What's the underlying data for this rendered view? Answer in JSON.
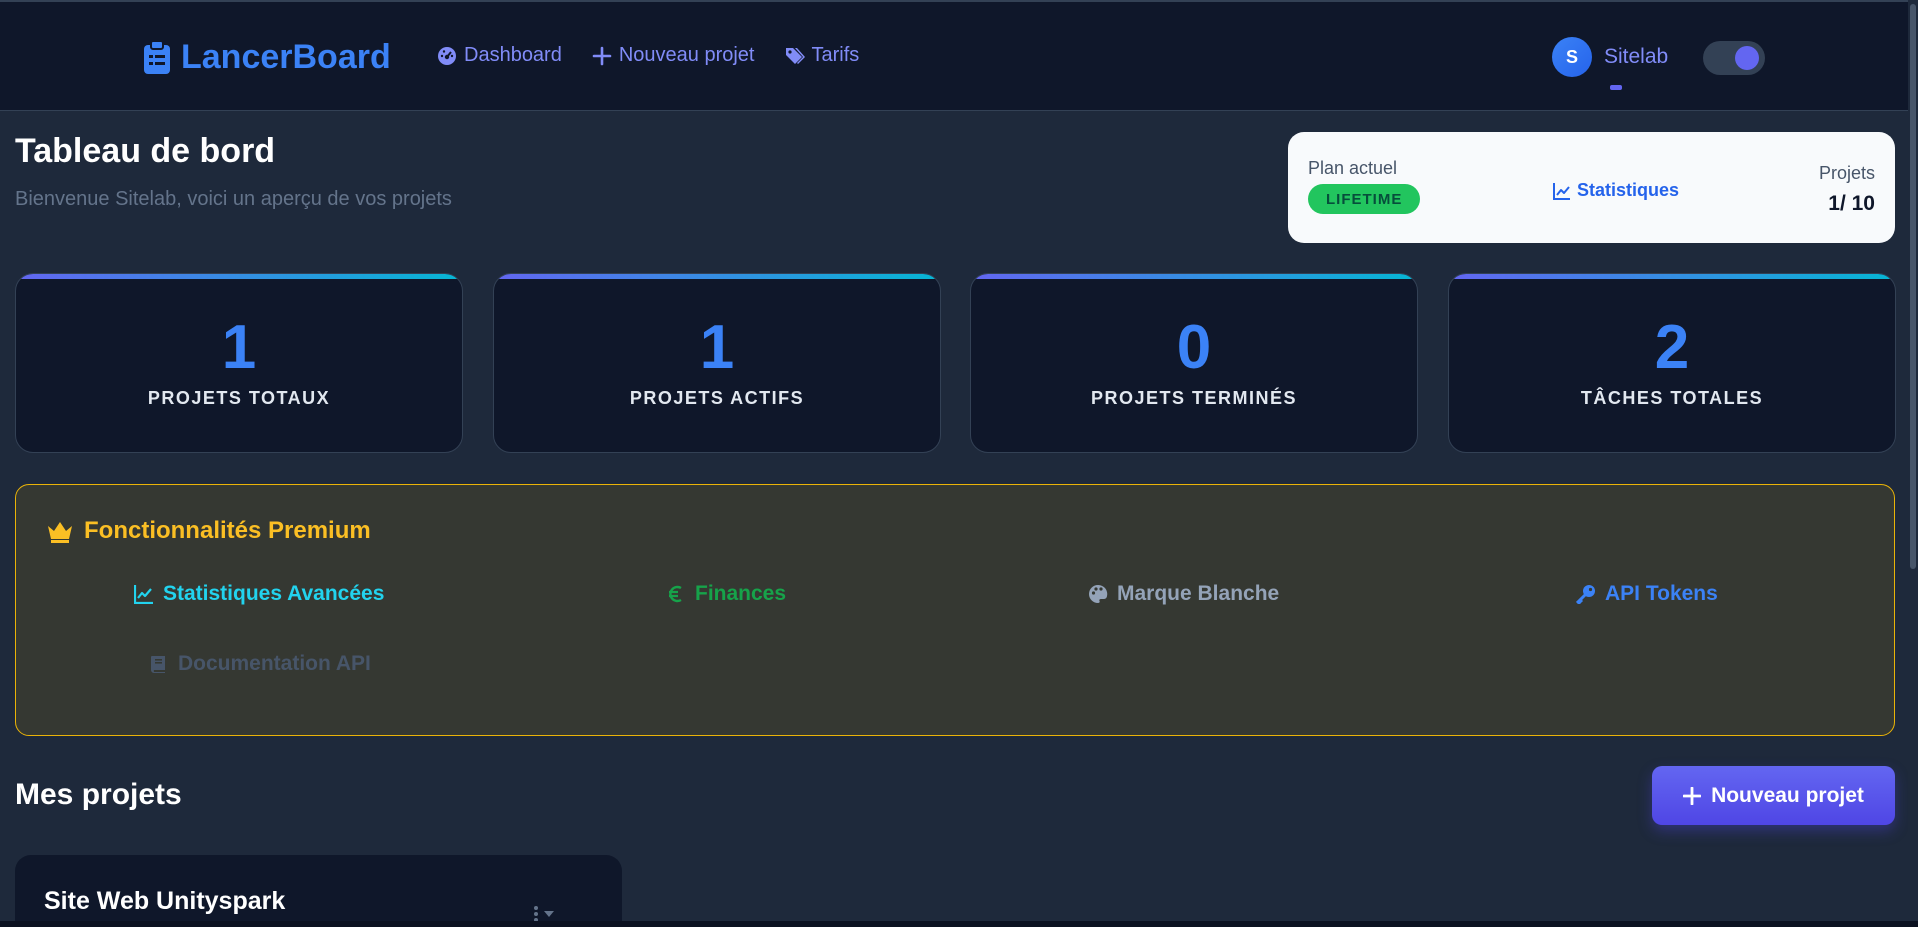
{
  "navbar": {
    "brand": "LancerBoard",
    "links": [
      {
        "label": "Dashboard",
        "icon": "gauge-icon"
      },
      {
        "label": "Nouveau projet",
        "icon": "plus-icon"
      },
      {
        "label": "Tarifs",
        "icon": "tags-icon"
      }
    ],
    "user": {
      "initial": "S",
      "name": "Sitelab"
    }
  },
  "header": {
    "title": "Tableau de bord",
    "subtitle": "Bienvenue Sitelab, voici un aperçu de vos projets"
  },
  "plan": {
    "label": "Plan actuel",
    "badge": "LIFETIME",
    "stats_link": "Statistiques",
    "projects_label": "Projets",
    "projects_value": "1/ 10"
  },
  "stats": [
    {
      "value": "1",
      "label": "PROJETS TOTAUX"
    },
    {
      "value": "1",
      "label": "PROJETS ACTIFS"
    },
    {
      "value": "0",
      "label": "PROJETS TERMINÉS"
    },
    {
      "value": "2",
      "label": "TÂCHES TOTALES"
    }
  ],
  "premium": {
    "title": "Fonctionnalités Premium",
    "features": [
      {
        "label": "Statistiques Avancées",
        "icon": "line-chart-icon"
      },
      {
        "label": "Finances",
        "icon": "euro-icon"
      },
      {
        "label": "Marque Blanche",
        "icon": "palette-icon"
      },
      {
        "label": "API Tokens",
        "icon": "key-icon"
      },
      {
        "label": "Documentation API",
        "icon": "book-icon"
      }
    ]
  },
  "projects": {
    "title": "Mes projets",
    "new_button": "Nouveau projet",
    "items": [
      {
        "title": "Site Web Unityspark"
      }
    ]
  },
  "colors": {
    "background": "#1e293b",
    "navbar": "#0f172a",
    "brand": "#3b82f6",
    "accent": "#6366f1",
    "premium_border": "#eab308",
    "badge": "#22c55e"
  }
}
